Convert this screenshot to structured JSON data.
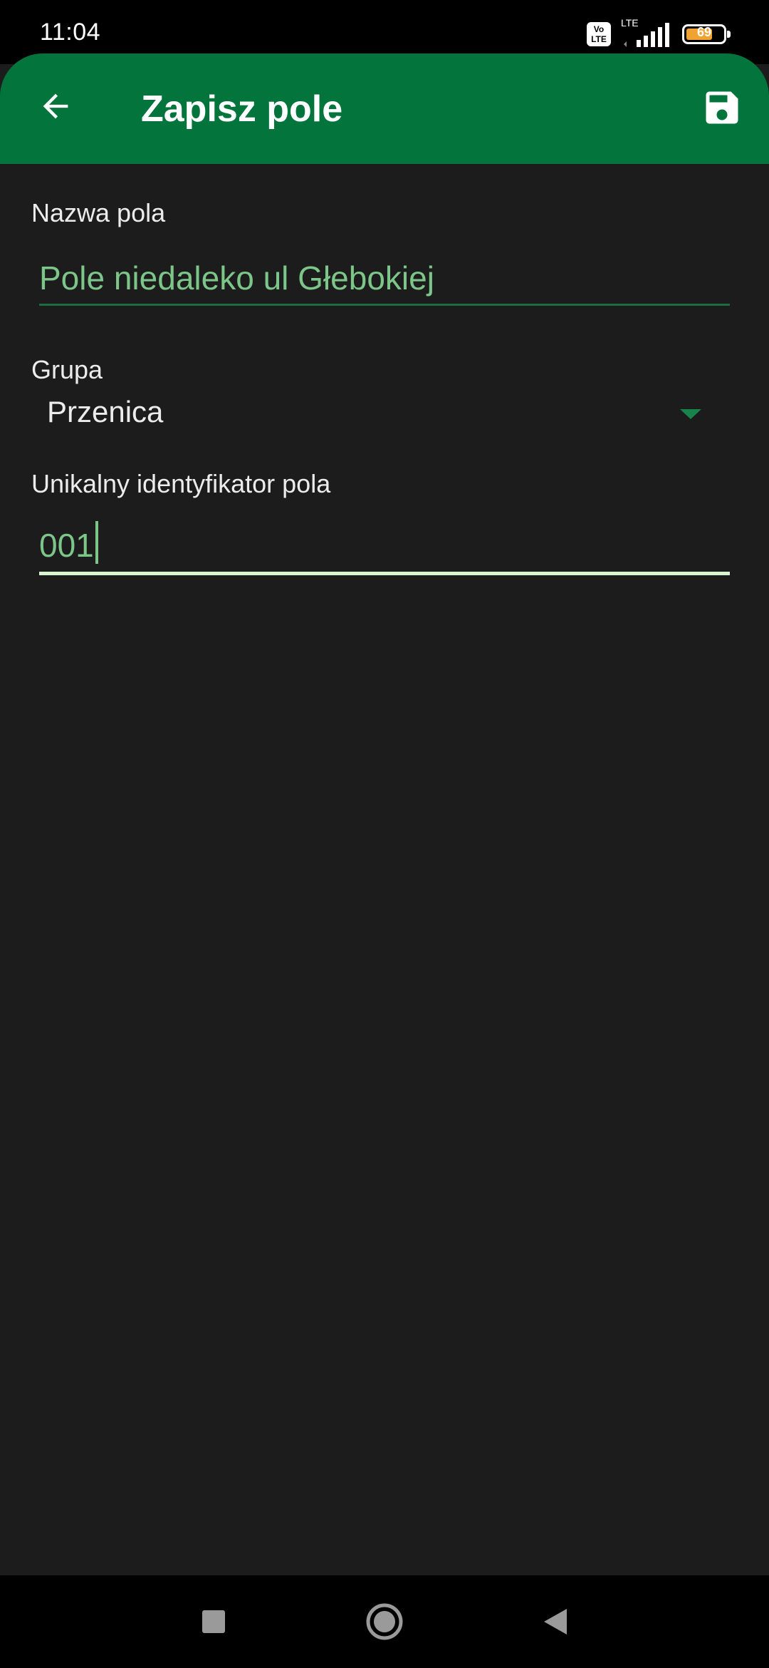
{
  "status_bar": {
    "time": "11:04",
    "volte_top": "Vo",
    "volte_bottom": "LTE",
    "network": "LTE",
    "battery": "69"
  },
  "app_bar": {
    "title": "Zapisz pole",
    "back_icon": "arrow-back-icon",
    "save_icon": "floppy-disk-icon",
    "color": "#02743c"
  },
  "form": {
    "name_field": {
      "label": "Nazwa pola",
      "value": "Pole niedaleko ul Głebokiej"
    },
    "group_field": {
      "label": "Grupa",
      "selected": "Przenica"
    },
    "id_field": {
      "label": "Unikalny identyfikator pola",
      "value": "001"
    }
  },
  "nav_bar": {
    "recents_icon": "square-recents-icon",
    "home_icon": "circle-home-icon",
    "back_icon": "triangle-back-icon"
  },
  "colors": {
    "background": "#1c1c1c",
    "accent_text": "#7dc68a",
    "active_underline": "#d8f5d2"
  }
}
